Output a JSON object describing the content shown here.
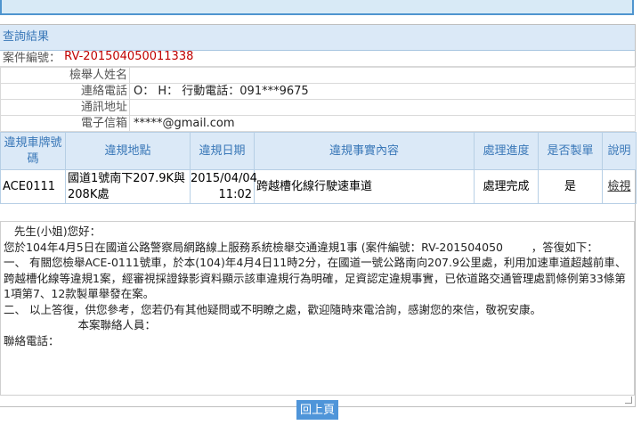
{
  "result": {
    "title": "查詢結果",
    "case_label": "案件編號：",
    "case_value": "RV-201504050011338"
  },
  "reporter": {
    "name_label": "檢舉人姓名",
    "name_value": "",
    "phone_label": "連絡電話",
    "phone_value": "O：  H：  行動電話：091***9675",
    "address_label": "通訊地址",
    "address_value": "",
    "email_label": "電子信箱",
    "email_value": "*****@gmail.com"
  },
  "violations": {
    "columns": [
      "違規車牌號碼",
      "違規地點",
      "違規日期",
      "違規事實內容",
      "處理進度",
      "是否製單",
      "說明"
    ],
    "rows": [
      {
        "plate": "ACE0111",
        "location": "國道1號南下207.9K與208K處",
        "date": "2015/04/04",
        "time": "11:02",
        "fact": "跨越槽化線行駛速車道",
        "status": "處理完成",
        "ticketed": "是",
        "detail_link": "檢視"
      }
    ]
  },
  "reply_text": "   先生(小姐)您好：\n您於104年4月5日在國道公路警察局網路線上服務系統檢舉交通違規1事 (案件編號：RV-201504050        ，答復如下：\n一、 有關您檢舉ACE-0111號車，於本(104)年4月4日11時2分，在國道一號公路南向207.9公里處，利用加速車道超越前車、跨越槽化線等違規1案，經審視採證錄影資料顯示該車違規行為明確，足資認定違規事實，已依道路交通管理處罰條例第33條第1項第7、12款製單舉發在案。\n二、 以上答復，供您參考，您若仍有其他疑問或不明瞭之處，歡迎隨時來電洽詢，感謝您的來信，敬祝安康。\n                     本案聯絡人員：\n聯絡電話：",
  "back_button": "回上頁"
}
